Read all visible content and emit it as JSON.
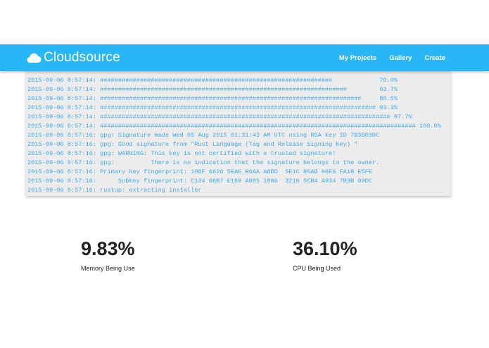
{
  "navbar": {
    "brand": "Cloudsource",
    "brand_icon": "cloud-icon",
    "links": [
      "My Projects",
      "Gallery",
      "Create"
    ]
  },
  "console": {
    "lines": [
      "2015-09-06 8:57:14: ################################################################             79.0%",
      "2015-09-06 8:57:14: ####################################################################         83.7%",
      "2015-09-06 8:57:14: ########################################################################     88.5%",
      "2015-09-06 8:57:14: ############################################################################ 93.3%",
      "2015-09-06 8:57:14: ################################################################################ 97.7%",
      "2015-09-06 8:57:14: ####################################################################################### 100.0%",
      "2015-09-06 8:57:16: gpg: Signature made Wed 05 Aug 2015 01:31:43 AM UTC using RSA key ID 7B3B09DC",
      "2015-09-06 8:57:16: gpg: Good signature from \"Rust Language (Tag and Release Signing Key) \"",
      "2015-09-06 8:57:16: gpg: WARNING: This key is not certified with a trusted signature!",
      "2015-09-06 8:57:16: gpg:          There is no indication that the signature belongs to the owner.",
      "2015-09-06 8:57:16: Primary key fingerprint: 108F 6620 5EAE B0AA A8DD  5E1C 85AB 96E6 FA1B E5FE",
      "2015-09-06 8:57:16:      Subkey fingerprint: C134 66B7 E169 A085 1886  3216 5CB4 A934 7B3B 09DC",
      "2015-09-06 8:57:16: rustup: extracting installer"
    ]
  },
  "stats": {
    "memory": {
      "value": "9.83%",
      "label": "Memory Being Use"
    },
    "cpu": {
      "value": "36.10%",
      "label": "CPU Being Used"
    }
  },
  "colors": {
    "navbar": "#29b6f6",
    "console_text": "#3fa9e8",
    "console_bg": "#ececec"
  }
}
